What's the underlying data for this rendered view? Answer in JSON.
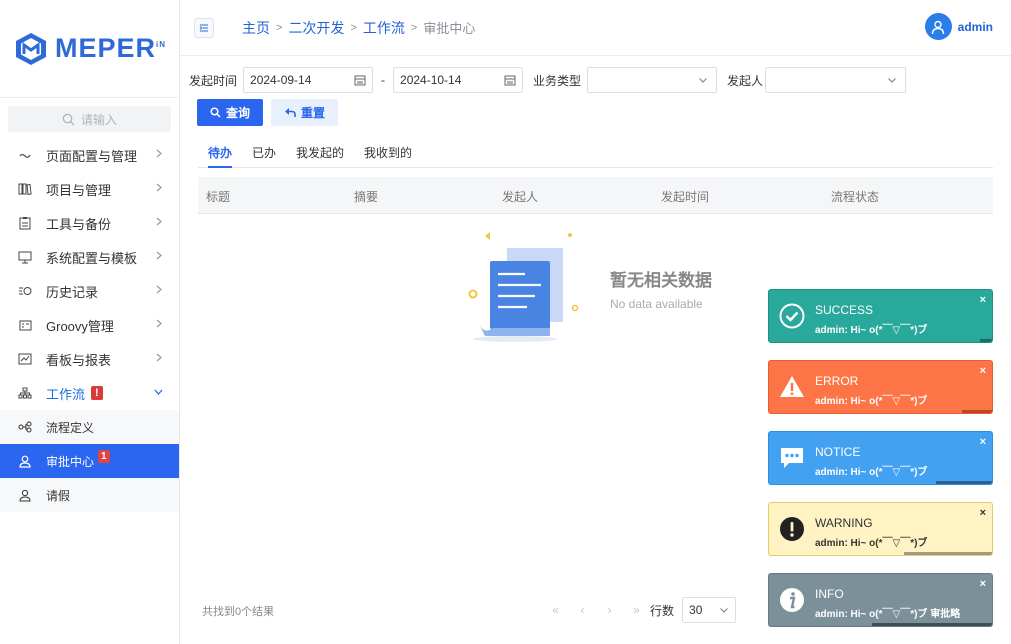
{
  "brand": {
    "name": "MEPER",
    "sup": "iN"
  },
  "search": {
    "placeholder": "请输入"
  },
  "menu": [
    {
      "label": "页面配置与管理"
    },
    {
      "label": "项目与管理"
    },
    {
      "label": "工具与备份"
    },
    {
      "label": "系统配置与模板"
    },
    {
      "label": "历史记录"
    },
    {
      "label": "Groovy管理"
    },
    {
      "label": "看板与报表"
    },
    {
      "label": "工作流",
      "badge": "!"
    }
  ],
  "submenu": [
    {
      "label": "流程定义"
    },
    {
      "label": "审批中心",
      "badge": "1"
    },
    {
      "label": "请假"
    }
  ],
  "breadcrumb": [
    "主页",
    "二次开发",
    "工作流",
    "审批中心"
  ],
  "user": {
    "name": "admin"
  },
  "filters": {
    "start_label": "发起时间",
    "start_date": "2024-09-14",
    "dash": "-",
    "end_date": "2024-10-14",
    "biz_label": "业务类型",
    "initiator_label": "发起人"
  },
  "actions": {
    "query": "查询",
    "reset": "重置"
  },
  "tabs": [
    "待办",
    "已办",
    "我发起的",
    "我收到的"
  ],
  "columns": [
    "标题",
    "摘要",
    "发起人",
    "发起时间",
    "流程状态"
  ],
  "empty": {
    "title": "暂无相关数据",
    "subtitle": "No data available"
  },
  "footer": {
    "result": "共找到0个结果"
  },
  "pager": {
    "first": "«",
    "prev": "‹",
    "next": "›",
    "last": "»",
    "rows_label": "行数",
    "rows_value": "30"
  },
  "toasts": [
    {
      "title": "SUCCESS",
      "message": "admin: Hi~ o(*￣▽￣*)ブ",
      "close": "×"
    },
    {
      "title": "ERROR",
      "message": "admin: Hi~ o(*￣▽￣*)ブ",
      "close": "×"
    },
    {
      "title": "NOTICE",
      "message": "admin: Hi~ o(*￣▽￣*)ブ",
      "close": "×"
    },
    {
      "title": "WARNING",
      "message": "admin: Hi~ o(*￣▽￣*)ブ",
      "close": "×"
    },
    {
      "title": "INFO",
      "message": "admin: Hi~ o(*￣▽￣*)ブ 审批略",
      "close": "×"
    }
  ],
  "colors": {
    "primary": "#2a66f0",
    "brand": "#2f6bd8",
    "success": "#29a99b",
    "error": "#fd7447",
    "notice": "#43a1f2",
    "warning": "#fff3c4",
    "info": "#7c9099"
  }
}
